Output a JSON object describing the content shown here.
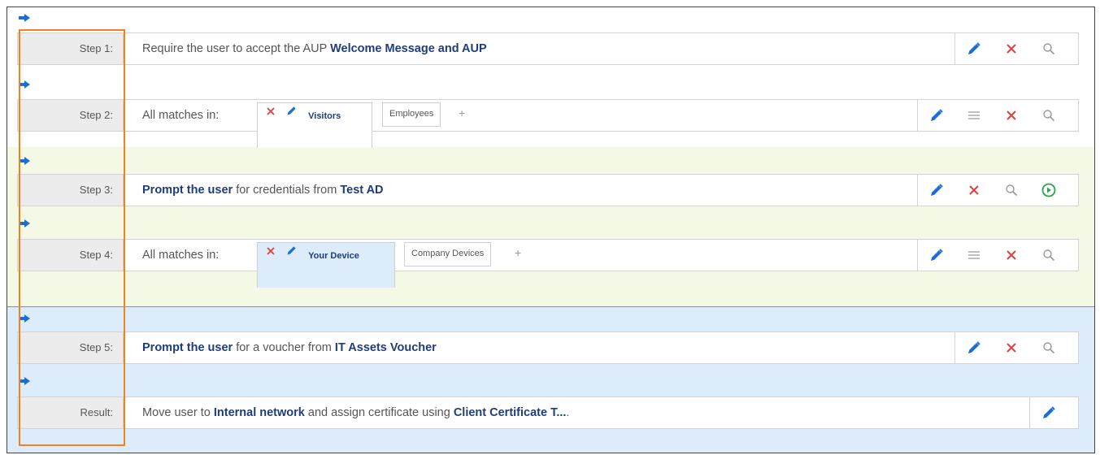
{
  "colors": {
    "accent": "#1a6fd1",
    "delete": "#e04040",
    "run": "#2ea44f",
    "highlight": "#f0811c"
  },
  "steps": [
    {
      "label": "Step 1:",
      "text_prefix": "Require the user to accept the AUP",
      "text_bold": "Welcome Message and AUP"
    },
    {
      "label": "Step 2:",
      "text_prefix": "All matches in:",
      "tabs": [
        "Visitors",
        "Employees"
      ],
      "add": "+"
    },
    {
      "label": "Step 3:",
      "text_bold_1": "Prompt the user",
      "text_mid": "for credentials from",
      "text_bold_2": "Test AD"
    },
    {
      "label": "Step 4:",
      "text_prefix": "All matches in:",
      "tabs": [
        "Your Device",
        "Company Devices"
      ],
      "add": "+"
    },
    {
      "label": "Step 5:",
      "text_bold_1": "Prompt the user",
      "text_mid": "for a voucher from",
      "text_bold_2": "IT Assets Voucher"
    }
  ],
  "result": {
    "label": "Result:",
    "text_prefix": "Move user to",
    "text_bold_1": "Internal network",
    "text_mid": "and assign certificate using",
    "text_bold_2": "Client Certificate T...",
    "text_suffix": "."
  },
  "icons": {
    "edit": "pencil-icon",
    "delete": "x-icon",
    "search": "magnifier-icon",
    "reorder": "hamburger-icon",
    "run": "play-circle-icon",
    "insert": "arrow-right-icon"
  }
}
